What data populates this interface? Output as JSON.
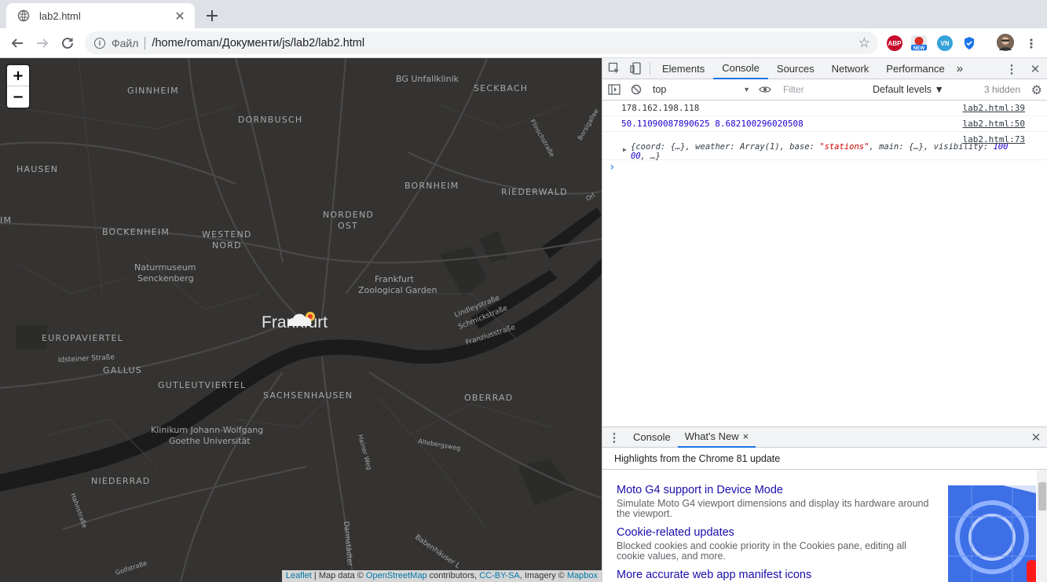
{
  "browser": {
    "tab_title": "lab2.html",
    "scheme_label": "Файл",
    "url": "/home/roman/Документи/js/lab2/lab2.html",
    "extensions": [
      {
        "name": "adblock-icon",
        "label": "ABP",
        "color": "#c70d2c"
      },
      {
        "name": "new-badge-extension-icon",
        "label": "NEW",
        "color": "#1a73e8"
      },
      {
        "name": "vpn-extension-icon",
        "label": "",
        "color": "#36a3d9"
      },
      {
        "name": "shield-extension-icon",
        "label": "",
        "color": "#1a73e8"
      }
    ]
  },
  "map": {
    "zoom_in": "+",
    "zoom_out": "−",
    "city_label": "Frankfurt",
    "labels": [
      {
        "text": "BG Unfallklinik",
        "cls": "poi"
      },
      {
        "text": "SECKBACH",
        "cls": "district"
      },
      {
        "text": "GINNHEIM",
        "cls": "district"
      },
      {
        "text": "DORNBUSCH",
        "cls": "district"
      },
      {
        "text": "HAUSEN",
        "cls": "district"
      },
      {
        "text": "BORNHEIM",
        "cls": "district"
      },
      {
        "text": "RIEDERWALD",
        "cls": "district"
      },
      {
        "text": "NORDEND",
        "cls": "district"
      },
      {
        "text": "OST",
        "cls": "district"
      },
      {
        "text": "BOCKENHEIM",
        "cls": "district"
      },
      {
        "text": "WESTEND",
        "cls": "district"
      },
      {
        "text": "NORD",
        "cls": "district"
      },
      {
        "text": "Naturmuseum",
        "cls": "poi"
      },
      {
        "text": "Senckenberg",
        "cls": "poi"
      },
      {
        "text": "Frankfurt",
        "cls": "poi"
      },
      {
        "text": "Zoological Garden",
        "cls": "poi"
      },
      {
        "text": "EUROPAVIERTEL",
        "cls": "district"
      },
      {
        "text": "Idsteiner Straße",
        "cls": "street"
      },
      {
        "text": "GALLUS",
        "cls": "district"
      },
      {
        "text": "GUTLEUTVIERTEL",
        "cls": "district"
      },
      {
        "text": "SACHSENHAUSEN",
        "cls": "district"
      },
      {
        "text": "OBERRAD",
        "cls": "district"
      },
      {
        "text": "Klinikum Johann-Wolfgang",
        "cls": "poi"
      },
      {
        "text": "Goethe Universität",
        "cls": "poi"
      },
      {
        "text": "NIEDERRAD",
        "cls": "district"
      },
      {
        "text": "Lindleystraße",
        "cls": "street"
      },
      {
        "text": "Schmickstraße",
        "cls": "street"
      },
      {
        "text": "Franziusstraße",
        "cls": "street"
      },
      {
        "text": "Flinschstraße",
        "cls": "street"
      },
      {
        "text": "Borsigallee",
        "cls": "street"
      },
      {
        "text": "Hainer Weg",
        "cls": "street"
      },
      {
        "text": "Altebergsweg",
        "cls": "street"
      },
      {
        "text": "Hahnstraße",
        "cls": "street"
      },
      {
        "text": "Darmstädter",
        "cls": "street"
      },
      {
        "text": "Babenhäuser L",
        "cls": "street"
      },
      {
        "text": "Golfstraße",
        "cls": "street"
      },
      {
        "text": "IM",
        "cls": "district"
      },
      {
        "text": "Orl",
        "cls": "street"
      }
    ],
    "attribution": {
      "leaflet": "Leaflet",
      "text1": " | Map data © ",
      "osm": "OpenStreetMap",
      "text2": " contributors, ",
      "license": "CC-BY-SA",
      "text3": ", Imagery © ",
      "mapbox": "Mapbox"
    }
  },
  "devtools": {
    "tabs": [
      "Elements",
      "Console",
      "Sources",
      "Network",
      "Performance"
    ],
    "active_tab": "Console",
    "more_tabs": "»",
    "context": "top",
    "filter_placeholder": "Filter",
    "levels": "Default levels ▼",
    "hidden": "3 hidden",
    "logs": [
      {
        "text": "178.162.198.118",
        "source": "lab2.html:39"
      },
      {
        "text": "50.11090087890625 8.682100296020508",
        "source": "lab2.html:50"
      },
      {
        "source": "lab2.html:73",
        "obj_line1_a": "{coord: {…}, weather: Array(1), base: ",
        "obj_str": "\"stations\"",
        "obj_line1_b": ", main: {…}, visibility: ",
        "obj_num": "100",
        "obj_line2_num": "00",
        "obj_line2": ", …}"
      }
    ],
    "prompt": "›",
    "drawer": {
      "tabs": [
        "Console",
        "What's New"
      ],
      "active_tab": "What's New",
      "close_tab": "×",
      "highlights": "Highlights from the Chrome 81 update",
      "items": [
        {
          "title": "Moto G4 support in Device Mode",
          "desc": "Simulate Moto G4 viewport dimensions and display its hardware around the viewport."
        },
        {
          "title": "Cookie-related updates",
          "desc": "Blocked cookies and cookie priority in the Cookies pane, editing all cookie values, and more."
        },
        {
          "title": "More accurate web app manifest icons",
          "desc": ""
        }
      ]
    }
  }
}
